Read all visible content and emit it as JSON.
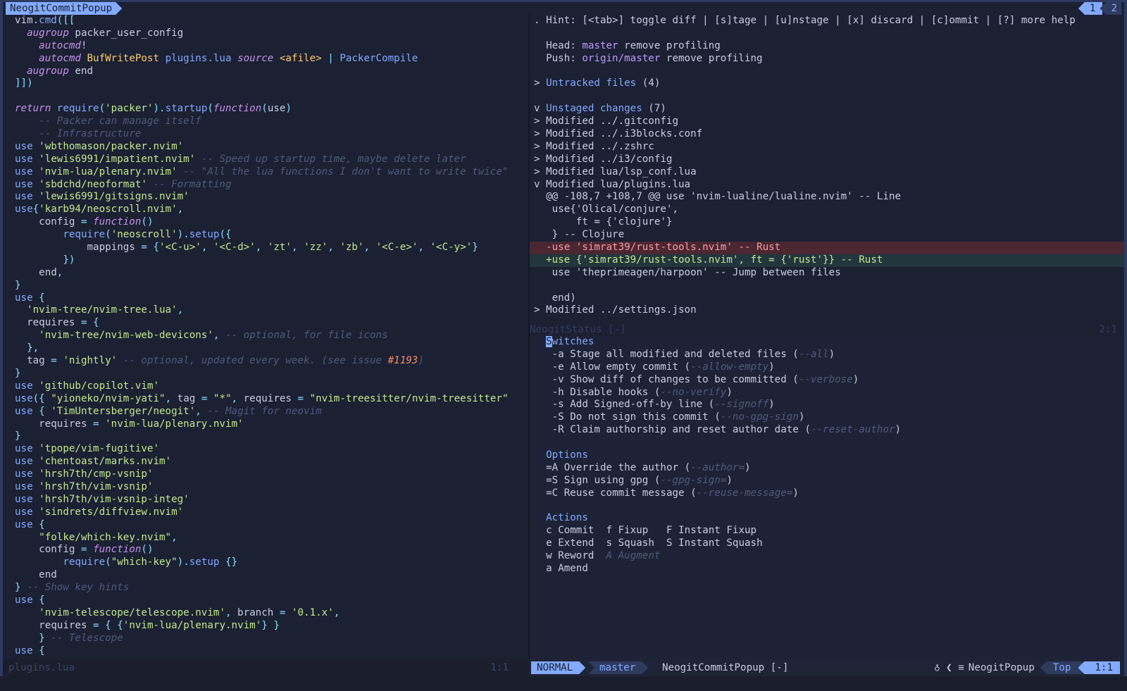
{
  "tabline": {
    "active_tab": "NeogitCommitPopup",
    "tab_numbers": [
      "1",
      "2"
    ]
  },
  "left_pane": {
    "lines": [
      [
        [
          "var",
          "vim"
        ],
        [
          "op",
          "."
        ],
        [
          "fn",
          "cmd"
        ],
        [
          "op",
          "([["
        ]
      ],
      [
        [
          "var",
          "  "
        ],
        [
          "kw",
          "augroup"
        ],
        [
          "var",
          " packer_user_config"
        ]
      ],
      [
        [
          "var",
          "    "
        ],
        [
          "kw",
          "autocmd"
        ],
        [
          "var",
          "!"
        ]
      ],
      [
        [
          "var",
          "    "
        ],
        [
          "kw",
          "autocmd"
        ],
        [
          "var",
          " "
        ],
        [
          "id",
          "BufWritePost"
        ],
        [
          "var",
          " "
        ],
        [
          "fn",
          "plugins.lua"
        ],
        [
          "var",
          " "
        ],
        [
          "kw",
          "source"
        ],
        [
          "var",
          " "
        ],
        [
          "id",
          "<afile>"
        ],
        [
          "var",
          " "
        ],
        [
          "op",
          "|"
        ],
        [
          "var",
          " "
        ],
        [
          "fn",
          "PackerCompile"
        ]
      ],
      [
        [
          "var",
          "  "
        ],
        [
          "kw",
          "augroup"
        ],
        [
          "var",
          " end"
        ]
      ],
      [
        [
          "op",
          "]])"
        ]
      ],
      [
        [
          "var",
          ""
        ]
      ],
      [
        [
          "kw",
          "return"
        ],
        [
          "var",
          " "
        ],
        [
          "fn",
          "require"
        ],
        [
          "op",
          "("
        ],
        [
          "str",
          "'packer'"
        ],
        [
          "op",
          ")."
        ],
        [
          "fn",
          "startup"
        ],
        [
          "op",
          "("
        ],
        [
          "kw",
          "function"
        ],
        [
          "op",
          "("
        ],
        [
          "var",
          "use"
        ],
        [
          "op",
          ")"
        ]
      ],
      [
        [
          "var",
          "    "
        ],
        [
          "cm",
          "-- Packer can manage itself"
        ]
      ],
      [
        [
          "var",
          "    "
        ],
        [
          "cm",
          "-- Infrastructure"
        ]
      ],
      [
        [
          "fn",
          "use"
        ],
        [
          "var",
          " "
        ],
        [
          "str",
          "'wbthomason/packer.nvim'"
        ]
      ],
      [
        [
          "fn",
          "use"
        ],
        [
          "var",
          " "
        ],
        [
          "str",
          "'lewis6991/impatient.nvim'"
        ],
        [
          "var",
          " "
        ],
        [
          "cm",
          "-- Speed up startup time, maybe delete later"
        ]
      ],
      [
        [
          "fn",
          "use"
        ],
        [
          "var",
          " "
        ],
        [
          "str",
          "'nvim-lua/plenary.nvim'"
        ],
        [
          "var",
          " "
        ],
        [
          "cm",
          "-- \"All the lua functions I don't want to write twice\""
        ]
      ],
      [
        [
          "fn",
          "use"
        ],
        [
          "var",
          " "
        ],
        [
          "str",
          "'sbdchd/neoformat'"
        ],
        [
          "var",
          " "
        ],
        [
          "cm",
          "-- Formatting"
        ]
      ],
      [
        [
          "fn",
          "use"
        ],
        [
          "var",
          " "
        ],
        [
          "str",
          "'lewis6991/gitsigns.nvim'"
        ]
      ],
      [
        [
          "fn",
          "use"
        ],
        [
          "op",
          "{"
        ],
        [
          "str",
          "'karb94/neoscroll.nvim'"
        ],
        [
          "op",
          ","
        ]
      ],
      [
        [
          "var",
          "    config "
        ],
        [
          "op",
          "="
        ],
        [
          "var",
          " "
        ],
        [
          "kw",
          "function"
        ],
        [
          "op",
          "()"
        ]
      ],
      [
        [
          "var",
          "        "
        ],
        [
          "fn",
          "require"
        ],
        [
          "op",
          "("
        ],
        [
          "str",
          "'neoscroll'"
        ],
        [
          "op",
          ")."
        ],
        [
          "fn",
          "setup"
        ],
        [
          "op",
          "({"
        ]
      ],
      [
        [
          "var",
          "            mappings "
        ],
        [
          "op",
          "="
        ],
        [
          "var",
          " "
        ],
        [
          "op",
          "{"
        ],
        [
          "str",
          "'<C-u>'"
        ],
        [
          "op",
          ", "
        ],
        [
          "str",
          "'<C-d>'"
        ],
        [
          "op",
          ", "
        ],
        [
          "str",
          "'zt'"
        ],
        [
          "op",
          ", "
        ],
        [
          "str",
          "'zz'"
        ],
        [
          "op",
          ", "
        ],
        [
          "str",
          "'zb'"
        ],
        [
          "op",
          ", "
        ],
        [
          "str",
          "'<C-e>'"
        ],
        [
          "op",
          ", "
        ],
        [
          "str",
          "'<C-y>'"
        ],
        [
          "op",
          "}"
        ]
      ],
      [
        [
          "var",
          "        "
        ],
        [
          "op",
          "})"
        ]
      ],
      [
        [
          "var",
          "    end"
        ],
        [
          "op",
          ","
        ]
      ],
      [
        [
          "op",
          "}"
        ]
      ],
      [
        [
          "fn",
          "use"
        ],
        [
          "var",
          " "
        ],
        [
          "op",
          "{"
        ]
      ],
      [
        [
          "var",
          "  "
        ],
        [
          "str",
          "'nvim-tree/nvim-tree.lua'"
        ],
        [
          "op",
          ","
        ]
      ],
      [
        [
          "var",
          "  requires "
        ],
        [
          "op",
          "="
        ],
        [
          "var",
          " "
        ],
        [
          "op",
          "{"
        ]
      ],
      [
        [
          "var",
          "    "
        ],
        [
          "str",
          "'nvim-tree/nvim-web-devicons'"
        ],
        [
          "op",
          ","
        ],
        [
          "var",
          " "
        ],
        [
          "cm",
          "-- optional, for file icons"
        ]
      ],
      [
        [
          "var",
          "  "
        ],
        [
          "op",
          "},"
        ]
      ],
      [
        [
          "var",
          "  tag "
        ],
        [
          "op",
          "="
        ],
        [
          "var",
          " "
        ],
        [
          "str",
          "'nightly'"
        ],
        [
          "var",
          " "
        ],
        [
          "cm",
          "-- optional, updated every week. (see issue "
        ],
        [
          "num",
          "#1193"
        ],
        [
          "cm",
          ")"
        ]
      ],
      [
        [
          "op",
          "}"
        ]
      ],
      [
        [
          "fn",
          "use"
        ],
        [
          "var",
          " "
        ],
        [
          "str",
          "'github/copilot.vim'"
        ]
      ],
      [
        [
          "fn",
          "use"
        ],
        [
          "op",
          "({"
        ],
        [
          "var",
          " "
        ],
        [
          "str",
          "\"yioneko/nvim-yati\""
        ],
        [
          "op",
          ","
        ],
        [
          "var",
          " tag "
        ],
        [
          "op",
          "="
        ],
        [
          "var",
          " "
        ],
        [
          "str",
          "\"*\""
        ],
        [
          "op",
          ","
        ],
        [
          "var",
          " requires "
        ],
        [
          "op",
          "="
        ],
        [
          "var",
          " "
        ],
        [
          "str",
          "\"nvim-treesitter/nvim-treesitter\""
        ]
      ],
      [
        [
          "fn",
          "use"
        ],
        [
          "var",
          " "
        ],
        [
          "op",
          "{"
        ],
        [
          "var",
          " "
        ],
        [
          "str",
          "'TimUntersberger/neogit'"
        ],
        [
          "op",
          ","
        ],
        [
          "var",
          " "
        ],
        [
          "cm",
          "-- Magit for neovim"
        ]
      ],
      [
        [
          "var",
          "    requires "
        ],
        [
          "op",
          "="
        ],
        [
          "var",
          " "
        ],
        [
          "str",
          "'nvim-lua/plenary.nvim'"
        ]
      ],
      [
        [
          "op",
          "}"
        ]
      ],
      [
        [
          "fn",
          "use"
        ],
        [
          "var",
          " "
        ],
        [
          "str",
          "'tpope/vim-fugitive'"
        ]
      ],
      [
        [
          "fn",
          "use"
        ],
        [
          "var",
          " "
        ],
        [
          "str",
          "'chentoast/marks.nvim'"
        ]
      ],
      [
        [
          "fn",
          "use"
        ],
        [
          "var",
          " "
        ],
        [
          "str",
          "'hrsh7th/cmp-vsnip'"
        ]
      ],
      [
        [
          "fn",
          "use"
        ],
        [
          "var",
          " "
        ],
        [
          "str",
          "'hrsh7th/vim-vsnip'"
        ]
      ],
      [
        [
          "fn",
          "use"
        ],
        [
          "var",
          " "
        ],
        [
          "str",
          "'hrsh7th/vim-vsnip-integ'"
        ]
      ],
      [
        [
          "fn",
          "use"
        ],
        [
          "var",
          " "
        ],
        [
          "str",
          "'sindrets/diffview.nvim'"
        ]
      ],
      [
        [
          "fn",
          "use"
        ],
        [
          "var",
          " "
        ],
        [
          "op",
          "{"
        ]
      ],
      [
        [
          "var",
          "    "
        ],
        [
          "str",
          "\"folke/which-key.nvim\""
        ],
        [
          "op",
          ","
        ]
      ],
      [
        [
          "var",
          "    config "
        ],
        [
          "op",
          "="
        ],
        [
          "var",
          " "
        ],
        [
          "kw",
          "function"
        ],
        [
          "op",
          "()"
        ]
      ],
      [
        [
          "var",
          "        "
        ],
        [
          "fn",
          "require"
        ],
        [
          "op",
          "("
        ],
        [
          "str",
          "\"which-key\""
        ],
        [
          "op",
          ")."
        ],
        [
          "fn",
          "setup"
        ],
        [
          "var",
          " "
        ],
        [
          "op",
          "{}"
        ]
      ],
      [
        [
          "var",
          "    end"
        ]
      ],
      [
        [
          "op",
          "}"
        ],
        [
          "var",
          " "
        ],
        [
          "cm",
          "-- Show key hints"
        ]
      ],
      [
        [
          "fn",
          "use"
        ],
        [
          "var",
          " "
        ],
        [
          "op",
          "{"
        ]
      ],
      [
        [
          "var",
          "    "
        ],
        [
          "str",
          "'nvim-telescope/telescope.nvim'"
        ],
        [
          "op",
          ","
        ],
        [
          "var",
          " branch "
        ],
        [
          "op",
          "="
        ],
        [
          "var",
          " "
        ],
        [
          "str",
          "'0.1.x'"
        ],
        [
          "op",
          ","
        ]
      ],
      [
        [
          "var",
          "    requires "
        ],
        [
          "op",
          "="
        ],
        [
          "var",
          " "
        ],
        [
          "op",
          "{"
        ],
        [
          "var",
          " "
        ],
        [
          "op",
          "{"
        ],
        [
          "str",
          "'nvim-lua/plenary.nvim'"
        ],
        [
          "op",
          "}"
        ],
        [
          "var",
          " "
        ],
        [
          "op",
          "}"
        ]
      ],
      [
        [
          "var",
          "    "
        ],
        [
          "op",
          "}"
        ],
        [
          "var",
          " "
        ],
        [
          "cm",
          "-- Telescope"
        ]
      ],
      [
        [
          "fn",
          "use"
        ],
        [
          "var",
          " "
        ],
        [
          "op",
          "{"
        ]
      ]
    ],
    "status_filename": "plugins.lua",
    "status_position": "1:1"
  },
  "right_pane": {
    "top_lines": [
      [
        [
          "var",
          ". Hint: [<tab>] toggle diff | [s]tage | [u]nstage | [x] discard | [c]ommit | [?] more help"
        ]
      ],
      [
        [
          "var",
          ""
        ]
      ],
      [
        [
          "var",
          "  Head: "
        ],
        [
          "hash",
          "master"
        ],
        [
          "var",
          " remove profiling"
        ]
      ],
      [
        [
          "var",
          "  Push: "
        ],
        [
          "hash",
          "origin/master"
        ],
        [
          "var",
          " remove profiling"
        ]
      ],
      [
        [
          "var",
          ""
        ]
      ],
      [
        [
          "var",
          "> "
        ],
        [
          "hl",
          "Untracked files"
        ],
        [
          "var",
          " (4)"
        ]
      ],
      [
        [
          "var",
          ""
        ]
      ],
      [
        [
          "var",
          "v "
        ],
        [
          "hl",
          "Unstaged changes"
        ],
        [
          "var",
          " (7)"
        ]
      ],
      [
        [
          "var",
          "> Modified ../.gitconfig"
        ]
      ],
      [
        [
          "var",
          "> Modified ../.i3blocks.conf"
        ]
      ],
      [
        [
          "var",
          "> Modified ../.zshrc"
        ]
      ],
      [
        [
          "var",
          "> Modified ../i3/config"
        ]
      ],
      [
        [
          "var",
          "> Modified lua/lsp_conf.lua"
        ]
      ],
      [
        [
          "var",
          "v Modified lua/plugins.lua"
        ]
      ],
      [
        [
          "var",
          "  @@ -108,7 +108,7 @@ use 'nvim-lualine/lualine.nvim' -- Line"
        ]
      ],
      [
        [
          "var",
          "   use{'Olical/conjure',"
        ]
      ],
      [
        [
          "var",
          "       ft = {'clojure'}"
        ]
      ],
      [
        [
          "var",
          "   } -- Clojure"
        ]
      ],
      [
        [
          "del",
          "  -use 'simrat39/rust-tools.nvim' -- Rust"
        ]
      ],
      [
        [
          "add",
          "  +use {'simrat39/rust-tools.nvim', ft = {'rust'}} -- Rust"
        ]
      ],
      [
        [
          "var",
          "   use 'theprimeagen/harpoon' -- Jump between files"
        ]
      ],
      [
        [
          "var",
          ""
        ]
      ],
      [
        [
          "var",
          "   end)"
        ]
      ],
      [
        [
          "var",
          "> Modified ../settings.json"
        ]
      ]
    ],
    "mid_status": {
      "name": "NeogitStatus [-]",
      "position": "2:1"
    },
    "popup": {
      "switches_title": "Switches",
      "switches": [
        {
          "key": "-a",
          "desc": "Stage all modified and deleted files",
          "flag": "--all"
        },
        {
          "key": "-e",
          "desc": "Allow empty commit",
          "flag": "--allow-empty"
        },
        {
          "key": "-v",
          "desc": "Show diff of changes to be committed",
          "flag": "--verbose"
        },
        {
          "key": "-h",
          "desc": "Disable hooks",
          "flag": "--no-verify"
        },
        {
          "key": "-s",
          "desc": "Add Signed-off-by line",
          "flag": "--signoff"
        },
        {
          "key": "-S",
          "desc": "Do not sign this commit",
          "flag": "--no-gpg-sign"
        },
        {
          "key": "-R",
          "desc": "Claim authorship and reset author date",
          "flag": "--reset-author"
        }
      ],
      "options_title": "Options",
      "options": [
        {
          "key": "=A",
          "desc": "Override the author",
          "flag": "--author="
        },
        {
          "key": "=S",
          "desc": "Sign using gpg",
          "flag": "--gpg-sign="
        },
        {
          "key": "=C",
          "desc": "Reuse commit message",
          "flag": "--reuse-message="
        }
      ],
      "actions_title": "Actions",
      "actions": [
        [
          {
            "key": "c",
            "label": "Commit"
          },
          {
            "key": "f",
            "label": "Fixup"
          },
          {
            "key": "F",
            "label": "Instant Fixup"
          }
        ],
        [
          {
            "key": "e",
            "label": "Extend"
          },
          {
            "key": "s",
            "label": "Squash"
          },
          {
            "key": "S",
            "label": "Instant Squash"
          }
        ],
        [
          {
            "key": "w",
            "label": "Reword"
          },
          {
            "key": "A",
            "label": "Augment",
            "disabled": true
          },
          null
        ],
        [
          {
            "key": "a",
            "label": "Amend"
          },
          null,
          null
        ]
      ]
    }
  },
  "statusline": {
    "mode": "NORMAL",
    "branch_icon": "",
    "branch": "master",
    "filename": "NeogitCommitPopup [-]",
    "icons": "♁ ❮ ≡",
    "filetype": "NeogitPopup",
    "scroll": "Top",
    "position": "1:1"
  },
  "colors": {
    "background": "#1b2033",
    "accent": "#82aaff",
    "string": "#c3e88d",
    "keyword": "#c792ea",
    "comment": "#4f5a7a",
    "diff_delete_bg": "#4a2731",
    "diff_add_bg": "#22363d"
  }
}
